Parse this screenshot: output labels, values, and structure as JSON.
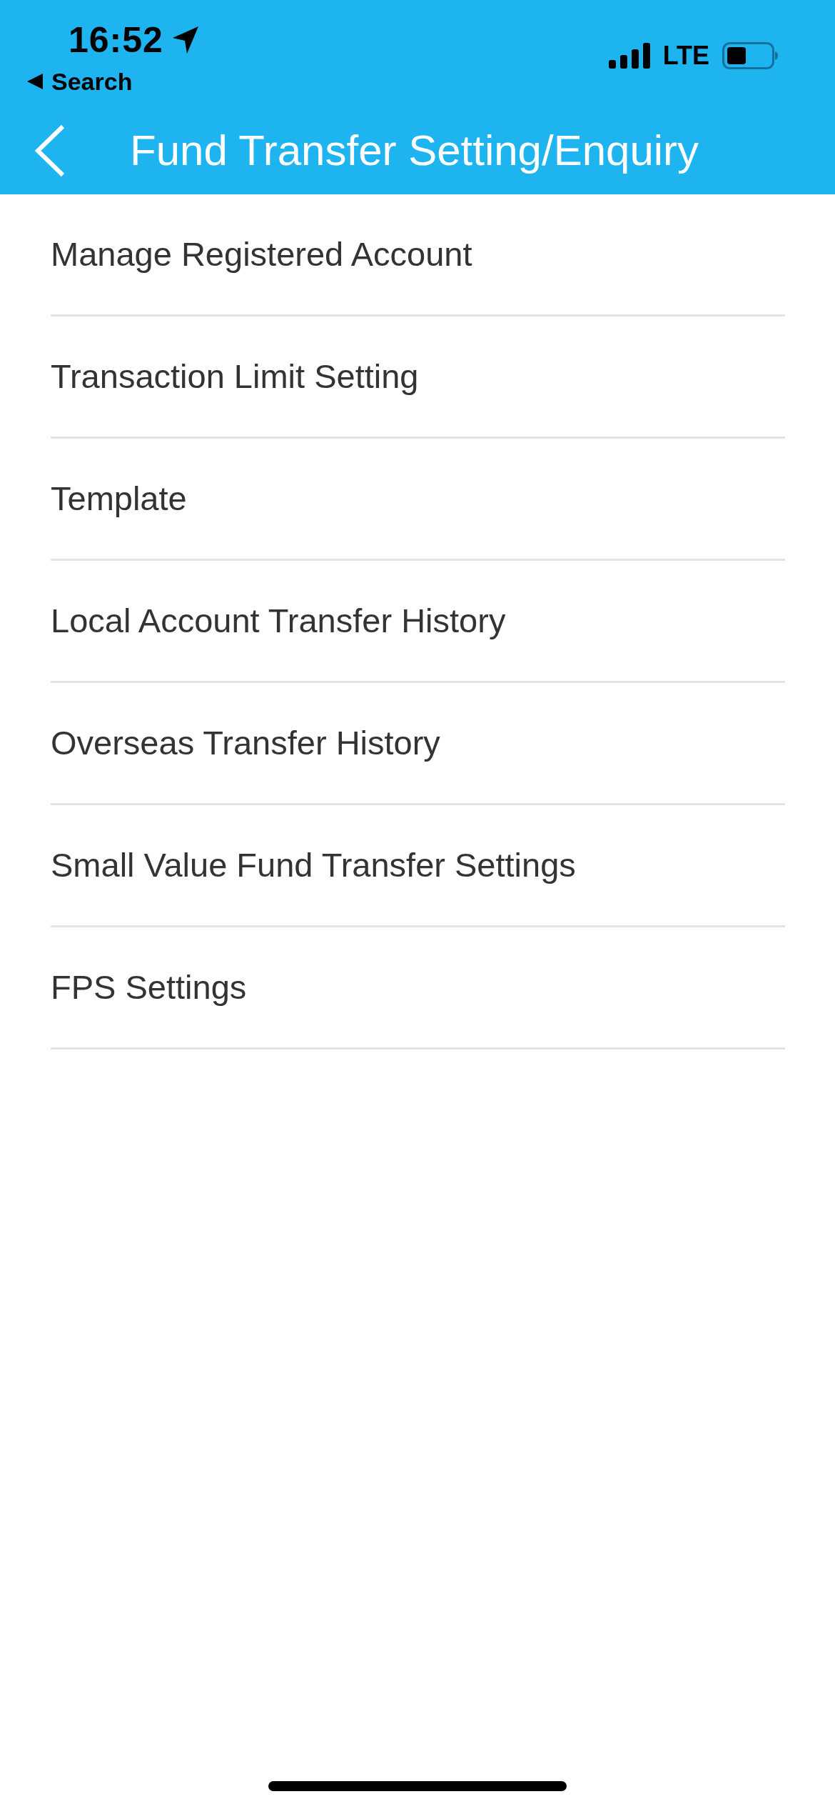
{
  "status_bar": {
    "time": "16:52",
    "back_app": "Search",
    "network": "LTE"
  },
  "nav_bar": {
    "title": "Fund Transfer Setting/Enquiry"
  },
  "menu_items": [
    {
      "label": "Manage Registered Account"
    },
    {
      "label": "Transaction Limit Setting"
    },
    {
      "label": "Template"
    },
    {
      "label": "Local Account Transfer History"
    },
    {
      "label": "Overseas Transfer History"
    },
    {
      "label": "Small Value Fund Transfer Settings"
    },
    {
      "label": "FPS Settings"
    }
  ]
}
